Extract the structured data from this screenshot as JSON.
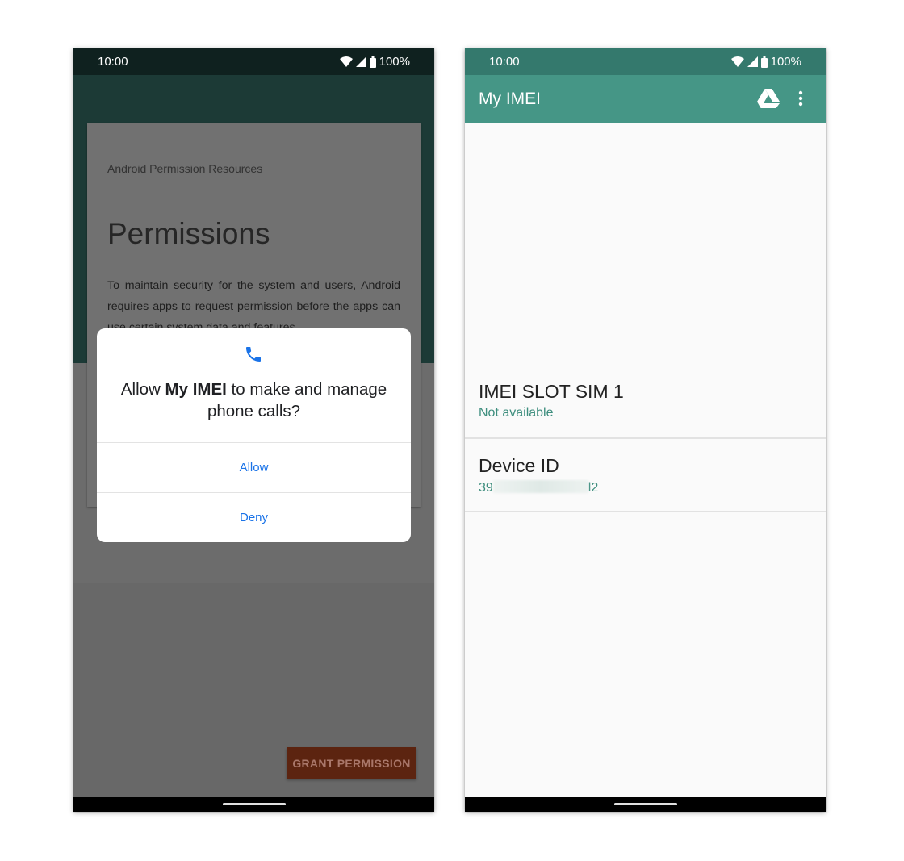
{
  "left_phone": {
    "status_bar": {
      "time": "10:00",
      "battery": "100%"
    },
    "background_card": {
      "eyebrow": "Android Permission Resources",
      "title": "Permissions",
      "body": "To maintain security for the system and users, Android requires apps to request permission before the apps can use certain system data and features."
    },
    "grant_button_label": "GRANT PERMISSION",
    "dialog": {
      "icon": "phone-icon",
      "message_before": "Allow ",
      "app_name": "My IMEI",
      "message_after": " to make and manage phone calls?",
      "allow_label": "Allow",
      "deny_label": "Deny"
    }
  },
  "right_phone": {
    "status_bar": {
      "time": "10:00",
      "battery": "100%"
    },
    "app_bar": {
      "title": "My IMEI",
      "actions": [
        "drive-icon",
        "more-vert-icon"
      ]
    },
    "rows": [
      {
        "title": "IMEI SLOT SIM 1",
        "value": "Not available"
      },
      {
        "title": "Device ID",
        "value_start": "39",
        "value_end": "l2"
      }
    ]
  },
  "colors": {
    "accent_teal": "#459686",
    "status_teal": "#34796d",
    "secondary_text": "#3e8e7e",
    "dialog_action": "#1a73e8",
    "grant_button": "#5c2410"
  }
}
